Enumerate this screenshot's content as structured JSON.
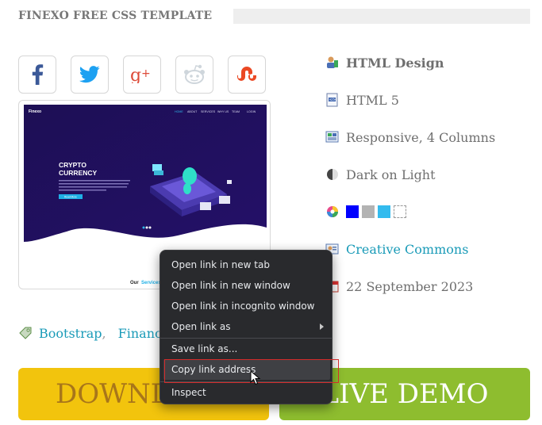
{
  "header": {
    "title": "FINEXO FREE CSS TEMPLATE"
  },
  "share": [
    {
      "name": "facebook",
      "icon": "facebook-icon",
      "color": "#3b5998"
    },
    {
      "name": "twitter",
      "icon": "twitter-icon",
      "color": "#1da1f2"
    },
    {
      "name": "google-plus",
      "icon": "google-plus-icon",
      "color": "#dd4b39"
    },
    {
      "name": "reddit",
      "icon": "reddit-icon",
      "color": "#cfd6dc"
    },
    {
      "name": "stumbleupon",
      "icon": "stumbleupon-icon",
      "color": "#eb4924"
    }
  ],
  "preview": {
    "brand": "Finexo",
    "nav": [
      "HOME",
      "ABOUT",
      "SERVICES",
      "WHY US",
      "TEAM",
      "LOGIN"
    ],
    "hero_line1": "CRYPTO",
    "hero_line2": "CURRENCY",
    "hero_button": "Read More",
    "section_title_a": "Our ",
    "section_title_b": "Services"
  },
  "meta": {
    "design": "HTML Design",
    "html": "HTML 5",
    "layout": "Responsive, 4 Columns",
    "theme": "Dark on Light",
    "colors": [
      "#0000ff",
      "#b3b3b3",
      "#33bbee",
      "#ffffff"
    ],
    "license": "Creative Commons",
    "date": "22 September 2023"
  },
  "tags": [
    "Bootstrap",
    "Finance"
  ],
  "buttons": {
    "download": "DOWNLOAD",
    "demo": "LIVE DEMO"
  },
  "context_menu": {
    "items": [
      "Open link in new tab",
      "Open link in new window",
      "Open link in incognito window",
      "Open link as",
      "Save link as...",
      "Copy link address",
      "Inspect"
    ]
  }
}
